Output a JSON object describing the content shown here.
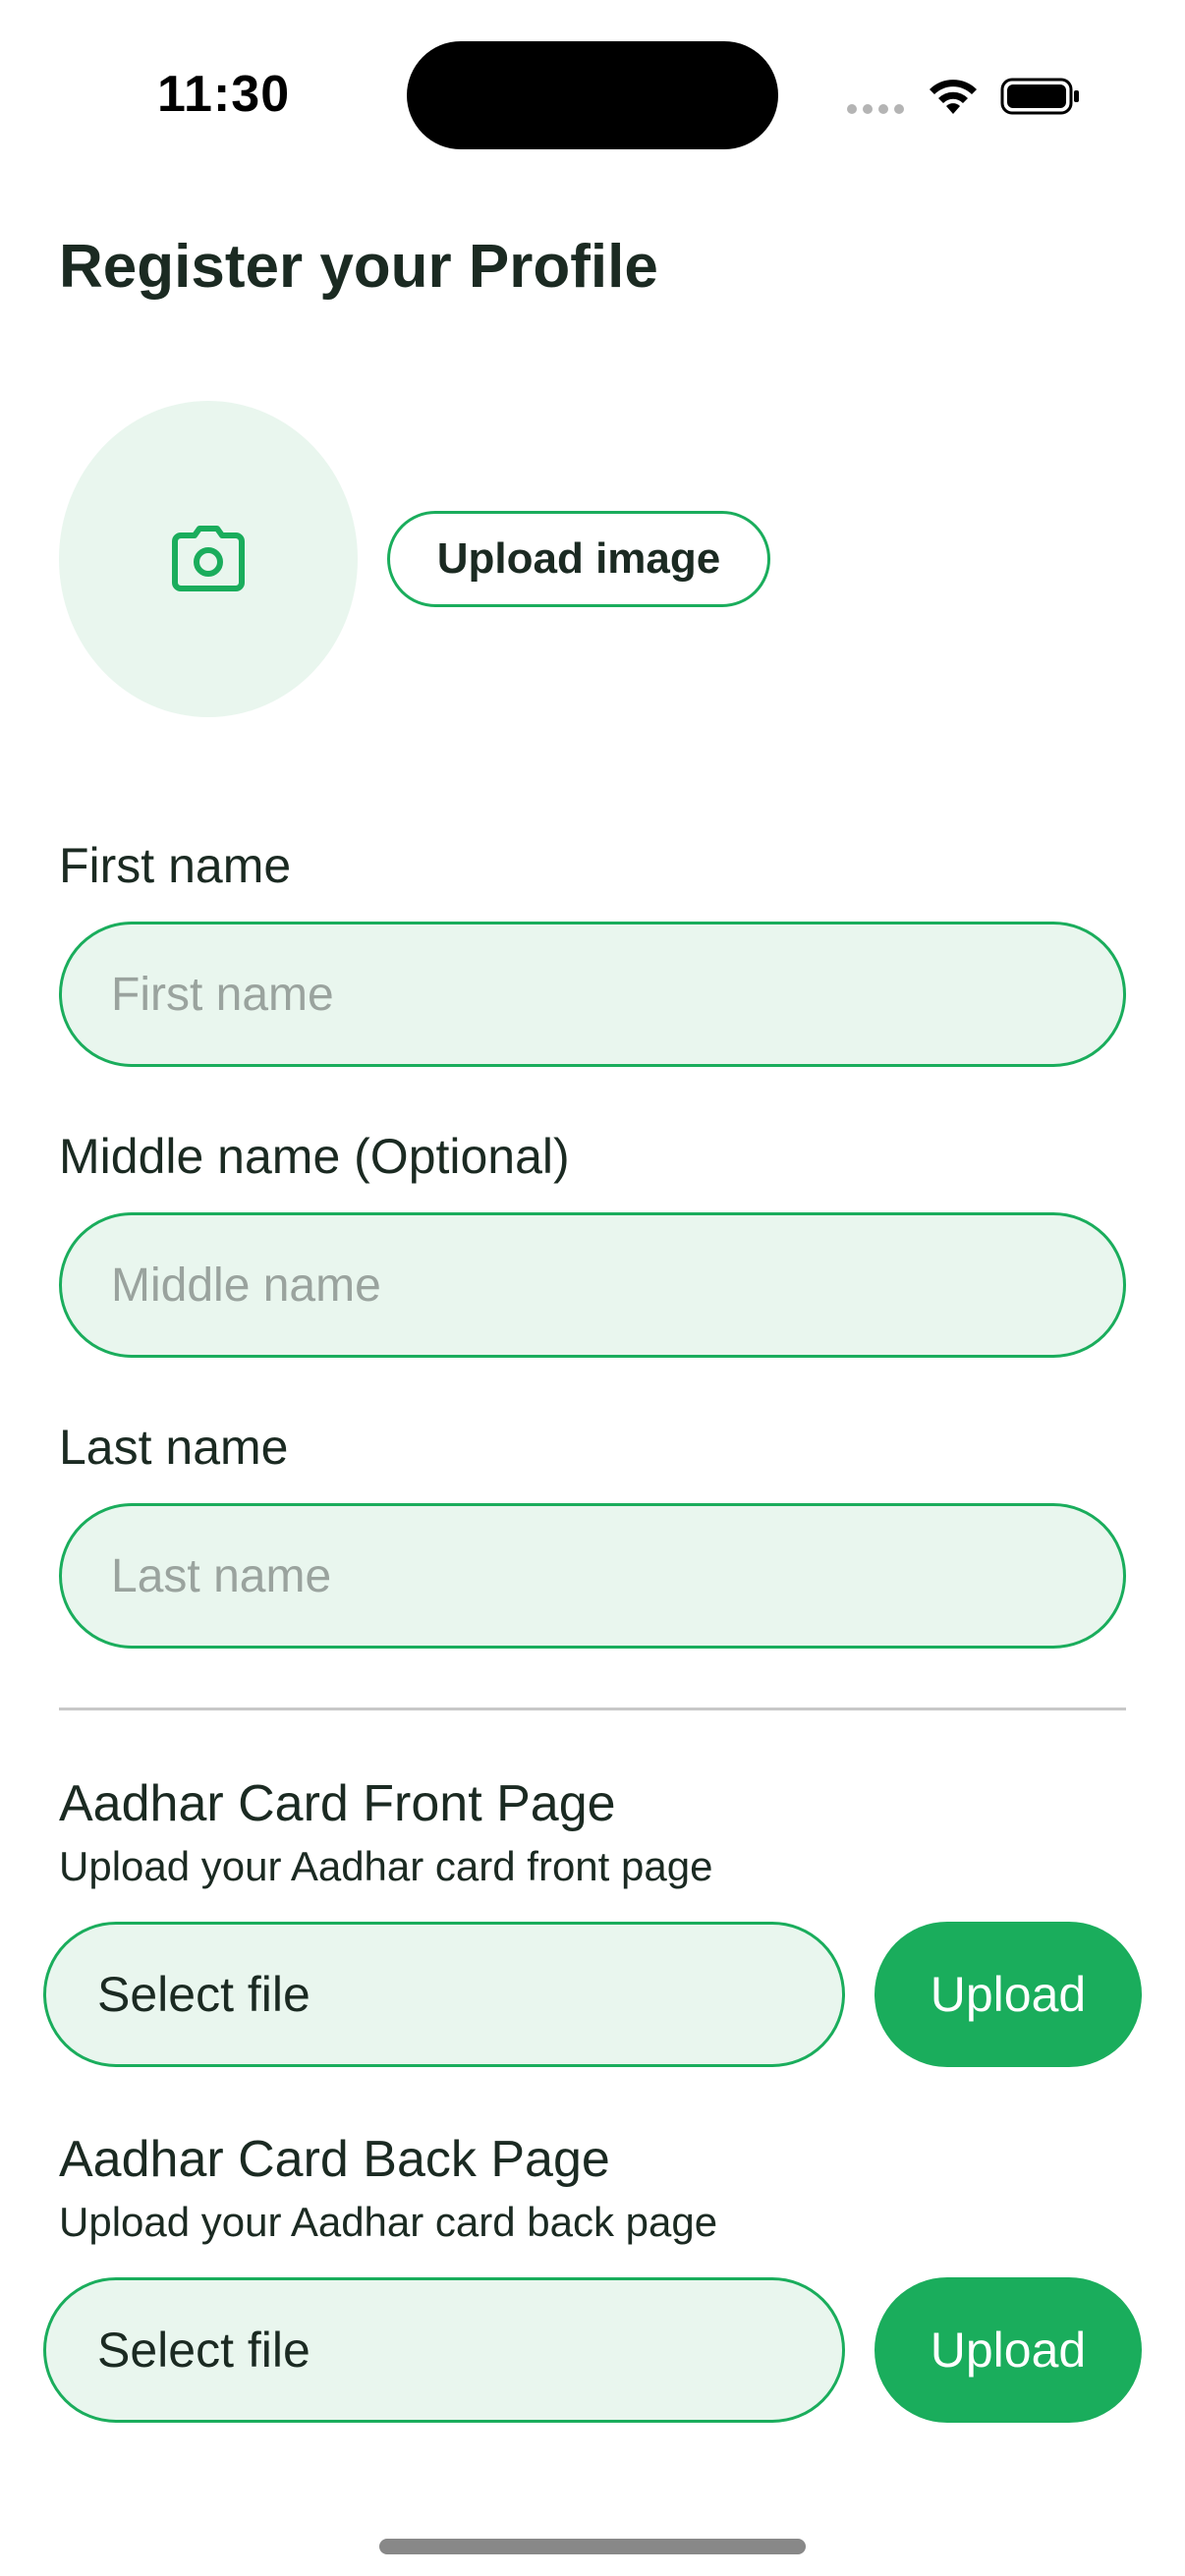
{
  "status_bar": {
    "time": "11:30"
  },
  "colors": {
    "accent": "#1aad5c",
    "field_background": "#e9f6ee",
    "text": "#1b2a22",
    "placeholder": "#9aa39e"
  },
  "header": {
    "title": "Register your Profile"
  },
  "profile_image": {
    "icon": "camera-icon",
    "upload_label": "Upload image"
  },
  "form": {
    "first_name": {
      "label": "First name",
      "placeholder": "First name",
      "value": ""
    },
    "middle_name": {
      "label": "Middle name (Optional)",
      "placeholder": "Middle name",
      "value": ""
    },
    "last_name": {
      "label": "Last name",
      "placeholder": "Last name",
      "value": ""
    }
  },
  "documents": [
    {
      "title": "Aadhar Card Front Page",
      "subtitle": "Upload your Aadhar card front page",
      "select_label": "Select file",
      "upload_label": "Upload"
    },
    {
      "title": "Aadhar Card Back Page",
      "subtitle": "Upload your Aadhar card back page",
      "select_label": "Select file",
      "upload_label": "Upload"
    }
  ]
}
